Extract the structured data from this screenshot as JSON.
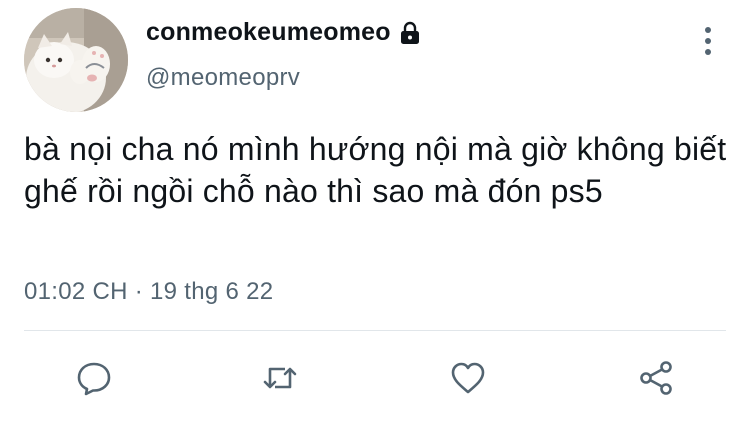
{
  "profile": {
    "display_name": "conmeokeumeomeo",
    "handle": "@meomeoprv",
    "protected": true
  },
  "tweet": {
    "text": "bà nọi cha nó mình hướng nội mà giờ không biết ghế rồi ngồi chỗ nào thì sao mà đón ps5",
    "meta": "01:02 CH · 19 thg 6 22"
  },
  "icons": {
    "lock": "lock-icon",
    "more": "more-vertical-icon",
    "reply": "reply-icon",
    "retweet": "retweet-icon",
    "like": "heart-icon",
    "share": "share-icon"
  },
  "colors": {
    "primary_text": "#0f1419",
    "secondary_text": "#536471",
    "divider": "#e1e6ea",
    "icon": "#536471"
  }
}
